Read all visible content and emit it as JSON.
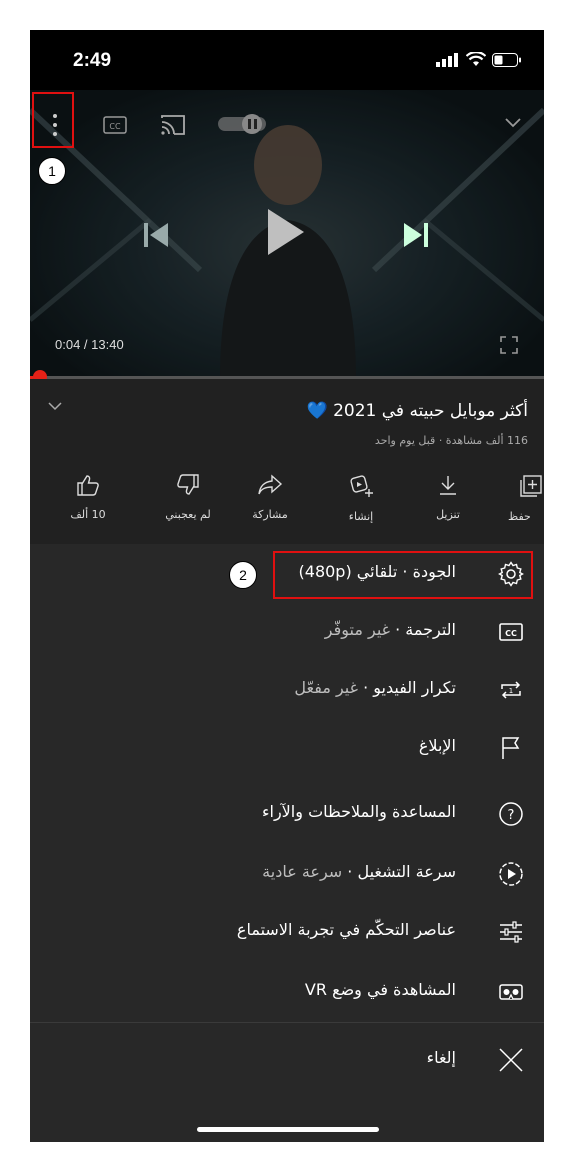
{
  "status_bar": {
    "time": "2:49"
  },
  "player": {
    "time_display": "0:04 / 13:40",
    "progress_fraction": 0.005
  },
  "video_info": {
    "title": "أكثر موبايل حبيته في 2021",
    "title_emoji": "💙",
    "meta": "116 ألف مشاهدة · قبل يوم واحد"
  },
  "actions": [
    {
      "label": "10 ألف",
      "icon": "thumbs-up-icon"
    },
    {
      "label": "لم يعجبني",
      "icon": "thumbs-down-icon"
    },
    {
      "label": "مشاركة",
      "icon": "share-icon"
    },
    {
      "label": "إنشاء",
      "icon": "create-icon"
    },
    {
      "label": "تنزيل",
      "icon": "download-icon"
    },
    {
      "label": "حفظ",
      "icon": "save-icon"
    }
  ],
  "menu": {
    "quality": {
      "label": "الجودة",
      "value": "تلقائي (480p)"
    },
    "captions": {
      "label": "الترجمة",
      "value": "غير متوفّر"
    },
    "loop": {
      "label": "تكرار الفيديو",
      "value": "غير مفعّل"
    },
    "report": {
      "label": "الإبلاغ"
    },
    "help": {
      "label": "المساعدة والملاحظات والآراء"
    },
    "speed": {
      "label": "سرعة التشغيل",
      "value": "سرعة عادية"
    },
    "listening": {
      "label": "عناصر التحكّم في تجربة الاستماع"
    },
    "vr": {
      "label": "المشاهدة في وضع VR"
    },
    "cancel": {
      "label": "إلغاء"
    }
  },
  "annotations": {
    "one": "1",
    "two": "2"
  },
  "colors": {
    "annotation_red": "#e01010",
    "progress_red": "#e62117",
    "heart_blue": "#2d6ad6"
  }
}
